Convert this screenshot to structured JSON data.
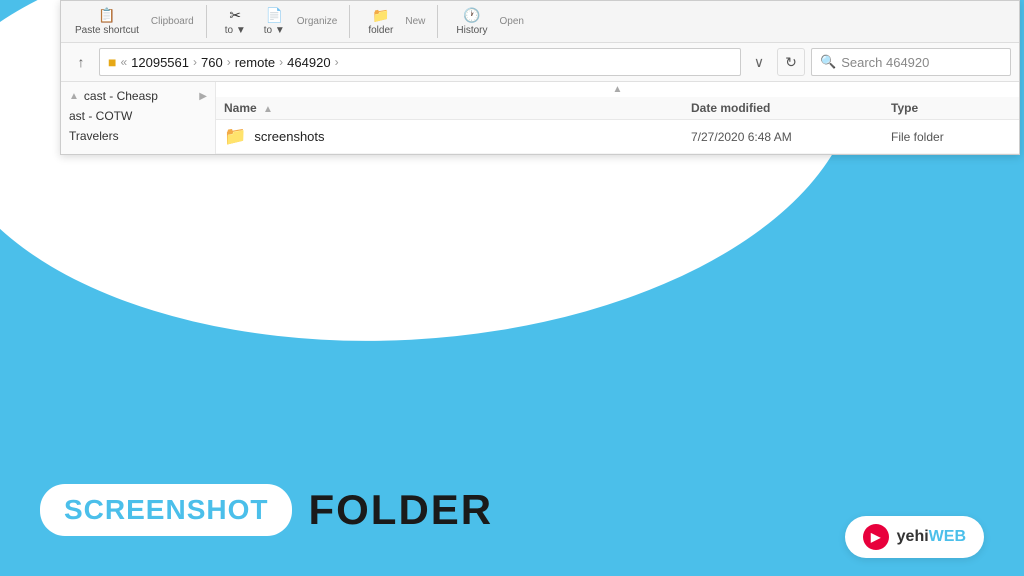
{
  "background_color": "#4bbfea",
  "toolbar": {
    "sections": [
      {
        "label": "Clipboard",
        "items": [
          {
            "icon": "📋",
            "name": "Paste shortcut"
          }
        ]
      },
      {
        "label": "Organize",
        "items": [
          {
            "icon": "✂",
            "name": "Cut",
            "label": "to"
          },
          {
            "icon": "📂",
            "name": "Copy",
            "label": "to"
          },
          {
            "icon": "▼",
            "name": "Move dropdown"
          }
        ]
      },
      {
        "label": "New",
        "items": [
          {
            "icon": "📁",
            "name": "folder"
          }
        ]
      },
      {
        "label": "Open",
        "items": [
          {
            "icon": "🕐",
            "name": "History"
          }
        ]
      }
    ]
  },
  "address_bar": {
    "back_button": "←",
    "up_button": "↑",
    "path": {
      "folder_icon": "📁",
      "separator": "«",
      "items": [
        "12095561",
        "760",
        "remote",
        "464920"
      ],
      "chevron": "›"
    },
    "dropdown_label": "∨",
    "refresh_label": "↻",
    "search": {
      "placeholder": "Search 464920",
      "icon": "🔍"
    }
  },
  "left_nav": {
    "items": [
      {
        "label": "cast - Cheasp",
        "has_scroll": true
      },
      {
        "label": "ast - COTW"
      },
      {
        "label": "Travelers"
      }
    ]
  },
  "file_list": {
    "columns": [
      {
        "label": "Name",
        "sort": "▲"
      },
      {
        "label": "Date modified"
      },
      {
        "label": "Type"
      }
    ],
    "files": [
      {
        "icon": "📁",
        "name": "screenshots",
        "date_modified": "7/27/2020 6:48 AM",
        "type": "File folder"
      }
    ]
  },
  "bottom_label": {
    "screenshot_text": "SCREENSHOT",
    "folder_text": "FOLDER"
  },
  "brand": {
    "logo_text": "▶",
    "name_part1": "yehi",
    "name_part2": "WEB"
  }
}
